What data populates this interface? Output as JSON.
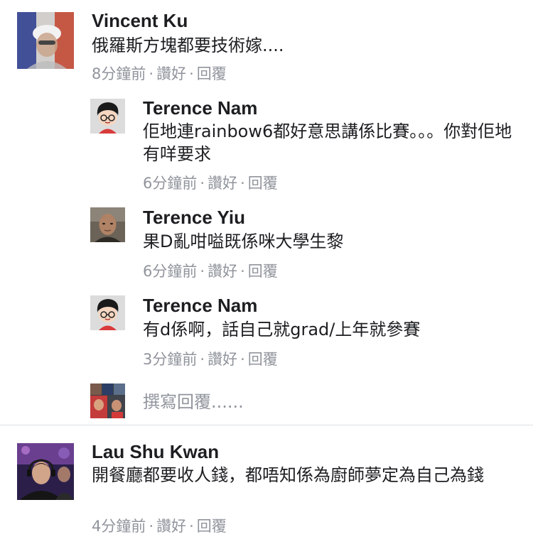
{
  "comments": [
    {
      "author": "Vincent Ku",
      "text": "俄羅斯方塊都要技術嫁....",
      "time": "8分鐘前",
      "like_label": "讚好",
      "reply_label": "回覆",
      "separator": "·",
      "avatar_icon": "vincent-avatar"
    },
    {
      "author": "Lau Shu Kwan",
      "text": "開餐廳都要收人錢，都唔知係為廚師夢定為自己為錢",
      "time": "4分鐘前",
      "like_label": "讚好",
      "reply_label": "回覆",
      "separator": "·",
      "avatar_icon": "lau-shu-kwan-avatar"
    }
  ],
  "replies": [
    {
      "author": "Terence Nam",
      "text": "佢地連rainbow6都好意思講係比賽。。。你對佢地有咩要求",
      "time": "6分鐘前",
      "like_label": "讚好",
      "reply_label": "回覆",
      "separator": "·",
      "avatar_icon": "cartoon-boy-avatar"
    },
    {
      "author": "Terence Yiu",
      "text": "果D亂咁嗌既係咪大學生黎",
      "time": "6分鐘前",
      "like_label": "讚好",
      "reply_label": "回覆",
      "separator": "·",
      "avatar_icon": "terence-yiu-avatar"
    },
    {
      "author": "Terence Nam",
      "text": "有d係啊，話自己就grad/上年就參賽",
      "time": "3分鐘前",
      "like_label": "讚好",
      "reply_label": "回覆",
      "separator": "·",
      "avatar_icon": "cartoon-boy-avatar"
    }
  ],
  "reply_box": {
    "placeholder": "撰寫回覆......",
    "avatar_icon": "current-user-avatar"
  },
  "colors": {
    "name": "#1c1e21",
    "text": "#1c1e21",
    "meta": "#90949c",
    "divider": "#dddfe2"
  }
}
